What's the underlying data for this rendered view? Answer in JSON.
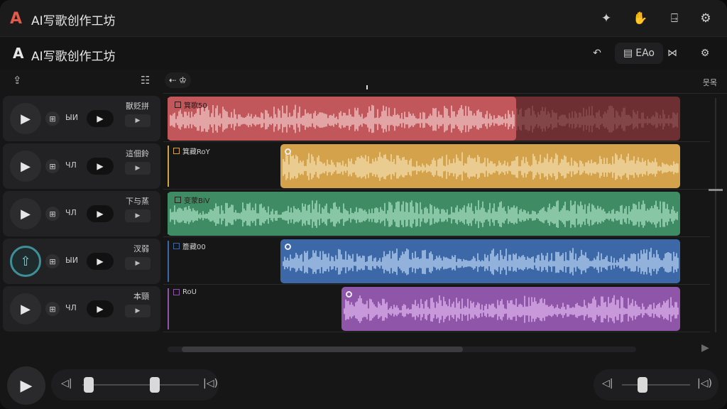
{
  "titlebar": {
    "logo": "A",
    "title": "AI写歌创作工坊",
    "buttons": [
      {
        "icon": "pinwheel-icon",
        "glyph": "✦"
      },
      {
        "icon": "hand-icon",
        "glyph": "✋"
      },
      {
        "icon": "export-icon",
        "glyph": "⍈"
      },
      {
        "icon": "settings-icon",
        "glyph": "⚙"
      }
    ]
  },
  "toolbar": {
    "logo": "A",
    "title": "AI写歌创作工坊",
    "undo_glyph": "↶",
    "ab_label": "EAo",
    "ab_glyph": "▤",
    "crossfade_glyph": "⋈",
    "settings_glyph": "⚙"
  },
  "sidebar": {
    "header_left_glyph": "⇪",
    "header_right_glyph": "☷"
  },
  "ruler": {
    "marker_label": "♔",
    "marker_glyph": "⇠",
    "right_label": "뭇목"
  },
  "tracks": [
    {
      "name": "獸贬拼",
      "mini_label": "ЫИ",
      "small_btn": "▶",
      "active": false,
      "clip_label": "箕歌50",
      "color": "#c2575b",
      "color_dark": "#6e2f33",
      "wave": "#f0c6c4",
      "clip_start": 0,
      "clip_end": 0.68,
      "dark_end": 1.0
    },
    {
      "name": "這佃鈴",
      "mini_label": "ЧЛ",
      "small_btn": "▶",
      "active": false,
      "clip_label": "箕藏RoY",
      "color": "#d4a24a",
      "wave": "#f3dfae",
      "clip_start": 0.22,
      "clip_end": 1.0
    },
    {
      "name": "下与蒸",
      "mini_label": "ЧЛ",
      "small_btn": "▶",
      "active": false,
      "clip_label": "变蒙BiV",
      "color": "#3f8c64",
      "wave": "#a8e0c3",
      "clip_start": 0,
      "clip_end": 1.0
    },
    {
      "name": "汊弱",
      "mini_label": "ЫИ",
      "small_btn": "▶",
      "active": true,
      "clip_label": "簷藏00",
      "color": "#3d68a8",
      "wave": "#b7d3f2",
      "clip_start": 0.22,
      "clip_end": 1.0
    },
    {
      "name": "本頸",
      "mini_label": "ЧЛ",
      "small_btn": "▶",
      "active": false,
      "clip_label": "RoU",
      "color": "#8e55a8",
      "wave": "#e2b6f0",
      "clip_start": 0.34,
      "clip_end": 1.0
    }
  ],
  "transport": {
    "play_glyph": "▶",
    "vol_low_glyph": "◁|",
    "vol_high_glyph": "|◁)",
    "master_position": 0.45,
    "master_volume": 0.35,
    "out_volume": 0.3
  },
  "scroll": {
    "h_arrow": "▶",
    "v_arrow_glyph": "▾"
  }
}
